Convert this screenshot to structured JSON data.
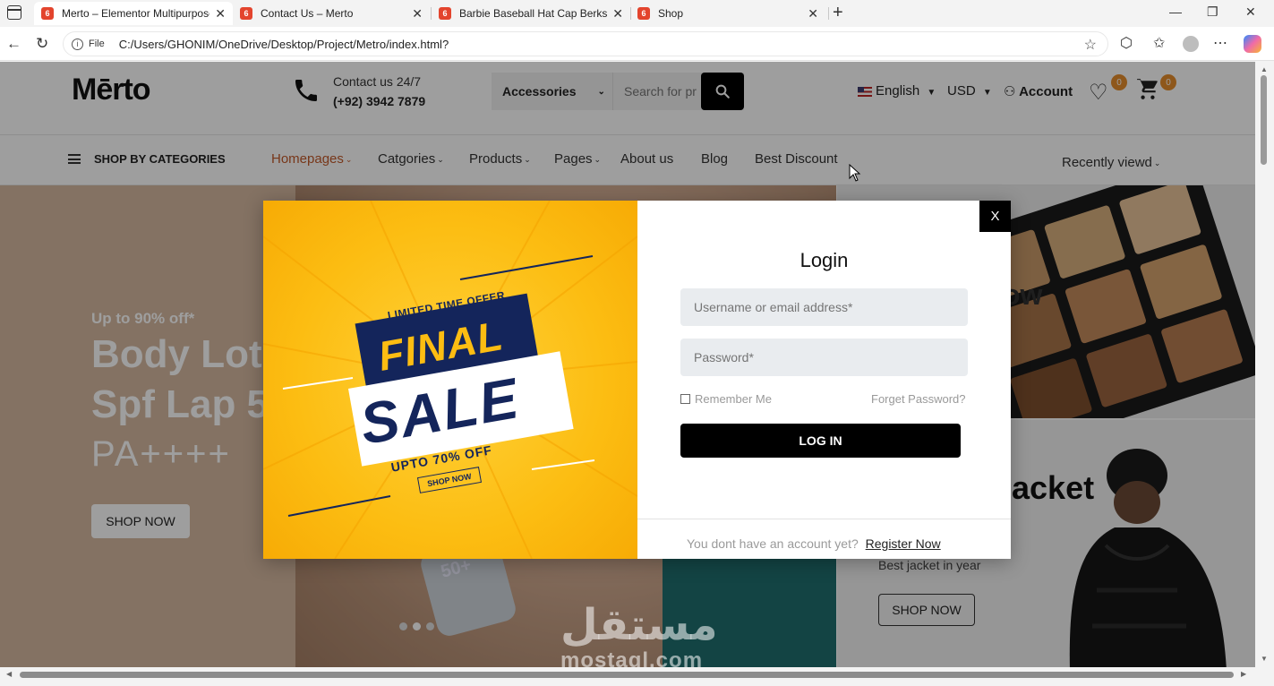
{
  "browser": {
    "tabs": [
      {
        "title": "Merto – Elementor Multipurpose",
        "active": true
      },
      {
        "title": "Contact Us – Merto",
        "active": false
      },
      {
        "title": "Barbie Baseball Hat Cap Berkshire",
        "active": false
      },
      {
        "title": "Shop",
        "active": false
      }
    ],
    "favicon_letter": "6",
    "url_scheme_label": "File",
    "url": "C:/Users/GHONIM/OneDrive/Desktop/Project/Metro/index.html?"
  },
  "header": {
    "logo": "Mērto",
    "contact_label": "Contact us 24/7",
    "contact_phone": "(+92) 3942 7879",
    "search_category": "Accessories",
    "search_placeholder": "Search for pr",
    "language": "English",
    "currency": "USD",
    "account": "Account",
    "wishlist_count": "0",
    "cart_count": "0"
  },
  "nav": {
    "categories_label": "SHOP BY CATEGORIES",
    "items": [
      {
        "label": "Homepages",
        "active": true,
        "dropdown": true
      },
      {
        "label": "Catgories",
        "active": false,
        "dropdown": true
      },
      {
        "label": "Products",
        "active": false,
        "dropdown": true
      },
      {
        "label": "Pages",
        "active": false,
        "dropdown": true
      },
      {
        "label": "About us",
        "active": false,
        "dropdown": false
      },
      {
        "label": "Blog",
        "active": false,
        "dropdown": false
      },
      {
        "label": "Best Discount",
        "active": false,
        "dropdown": false
      }
    ],
    "recently_viewed": "Recently viewd"
  },
  "hero": {
    "pretitle": "Up to 90% off*",
    "title_line1": "Body Lotion",
    "title_line2": "Spf Lap 50",
    "title_line3": "PA++++",
    "button": "SHOP NOW",
    "phone_text": "50+"
  },
  "promo_top": {
    "title_fragment": "ow"
  },
  "promo_bottom": {
    "title_fragment": "acket",
    "subtitle": "Best jacket in year",
    "button": "SHOP NOW"
  },
  "modal": {
    "close_label": "X",
    "banner": {
      "line1": "LIMITED TIME OFFER",
      "line2": "FINAL",
      "line3": "SALE",
      "line4": "UPTO 70% OFF",
      "line5": "SHOP NOW"
    },
    "title": "Login",
    "username_placeholder": "Username or email address*",
    "password_placeholder": "Password*",
    "remember_label": "Remember Me",
    "forget_label": "Forget Password?",
    "login_button": "LOG IN",
    "register_prompt": "You dont have an account yet?",
    "register_link": "Register Now"
  },
  "watermark": {
    "arabic": "مستقل",
    "latin": "mostaql.com"
  },
  "colors": {
    "accent_nav": "#c25a2a",
    "badge": "#e58d2d",
    "sale_yellow": "#fcbd12",
    "sale_navy": "#14255b"
  }
}
